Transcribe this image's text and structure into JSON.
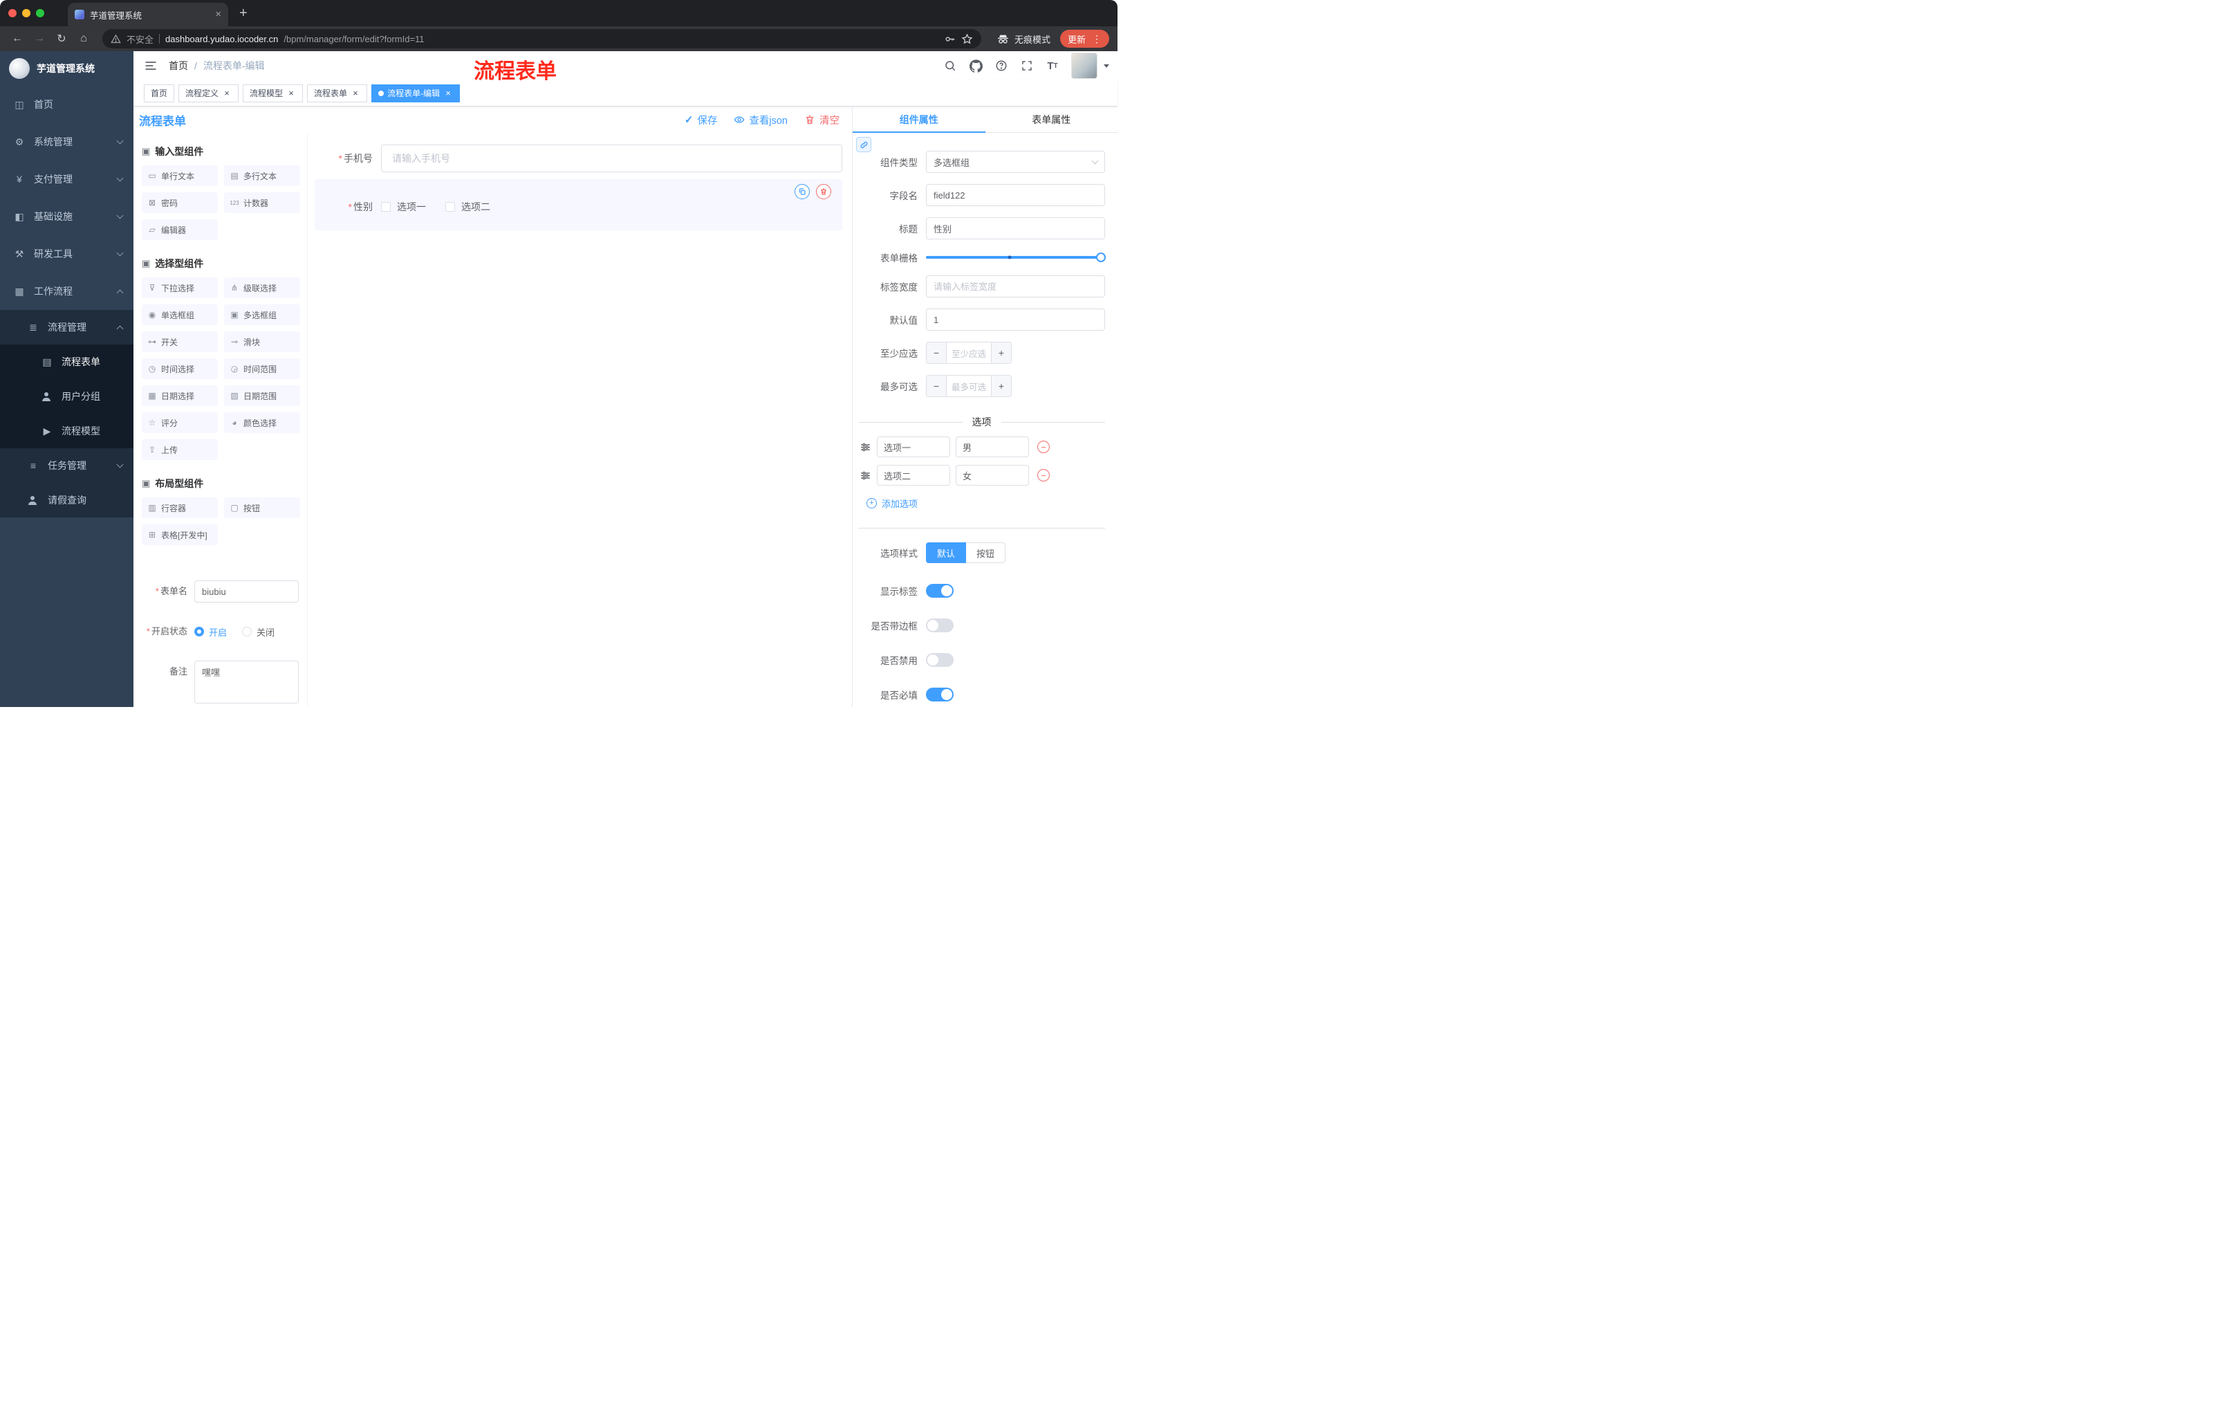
{
  "browser": {
    "tab_title": "芋道管理系统",
    "security_label": "不安全",
    "url_domain": "dashboard.yudao.iocoder.cn",
    "url_path": "/bpm/manager/form/edit?formId=11",
    "incognito_label": "无痕模式",
    "update_label": "更新"
  },
  "annotation": {
    "text": "流程表单"
  },
  "sidebar": {
    "app_title": "芋道管理系统",
    "items": [
      {
        "label": "首页"
      },
      {
        "label": "系统管理"
      },
      {
        "label": "支付管理"
      },
      {
        "label": "基础设施"
      },
      {
        "label": "研发工具"
      },
      {
        "label": "工作流程"
      },
      {
        "label": "流程管理"
      },
      {
        "label": "流程表单"
      },
      {
        "label": "用户分组"
      },
      {
        "label": "流程模型"
      },
      {
        "label": "任务管理"
      },
      {
        "label": "请假查询"
      }
    ]
  },
  "header": {
    "breadcrumb_home": "首页",
    "breadcrumb_sep": "/",
    "breadcrumb_current": "流程表单-编辑"
  },
  "tags": [
    {
      "label": "首页"
    },
    {
      "label": "流程定义"
    },
    {
      "label": "流程模型"
    },
    {
      "label": "流程表单"
    },
    {
      "label": "流程表单-编辑"
    }
  ],
  "ui": {
    "required_mark": "*"
  },
  "designer": {
    "title": "流程表单",
    "save": "保存",
    "view_json": "查看json",
    "clear": "清空",
    "group_input_title": "输入型组件",
    "group_select_title": "选择型组件",
    "group_layout_title": "布局型组件",
    "components_input": [
      "单行文本",
      "多行文本",
      "密码",
      "计数器",
      "编辑器"
    ],
    "components_select": [
      "下拉选择",
      "级联选择",
      "单选框组",
      "多选框组",
      "开关",
      "滑块",
      "时间选择",
      "时间范围",
      "日期选择",
      "日期范围",
      "评分",
      "颜色选择",
      "上传"
    ],
    "components_layout": [
      "行容器",
      "按钮",
      "表格[开发中]"
    ]
  },
  "form_config": {
    "name_label": "表单名",
    "name_value": "biubiu",
    "status_label": "开启状态",
    "status_on": "开启",
    "status_off": "关闭",
    "remark_label": "备注",
    "remark_value": "嘿嘿"
  },
  "canvas": {
    "phone_label": "手机号",
    "phone_placeholder": "请输入手机号",
    "gender_label": "性别",
    "option1": "选项一",
    "option2": "选项二"
  },
  "props": {
    "tab_component": "组件属性",
    "tab_form": "表单属性",
    "type_label": "组件类型",
    "type_value": "多选框组",
    "field_label": "字段名",
    "field_value": "field122",
    "title_label": "标题",
    "title_value": "性别",
    "grid_label": "表单栅格",
    "width_label": "标签宽度",
    "width_placeholder": "请输入标签宽度",
    "default_label": "默认值",
    "default_value": "1",
    "min_label": "至少应选",
    "min_placeholder": "至少应选",
    "max_label": "最多可选",
    "max_placeholder": "最多可选",
    "options_title": "选项",
    "opt1_label": "选项一",
    "opt1_value": "男",
    "opt2_label": "选项二",
    "opt2_value": "女",
    "add_option": "添加选项",
    "style_label": "选项样式",
    "style_default": "默认",
    "style_button": "按钮",
    "show_label": "显示标签",
    "border_label": "是否带边框",
    "disabled_label": "是否禁用",
    "required_label": "是否必填"
  },
  "colors": {
    "primary": "#409eff",
    "danger": "#f56c6c",
    "sidebar_bg": "#304156",
    "annotation": "#ff2a1c",
    "update_pill": "#e25746"
  }
}
